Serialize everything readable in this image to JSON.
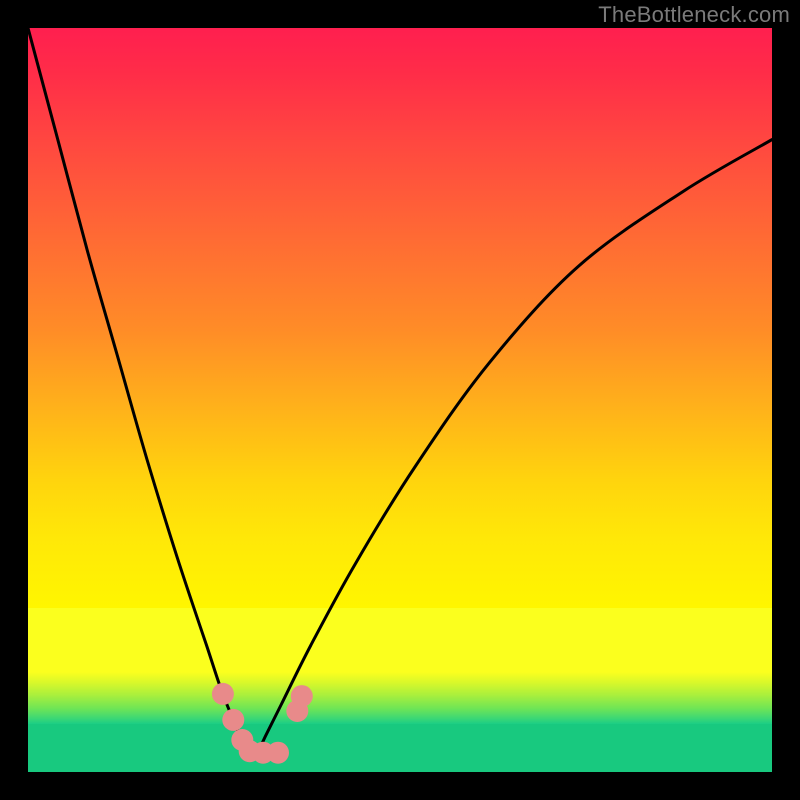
{
  "watermark": "TheBottleneck.com",
  "chart_data": {
    "type": "line",
    "title": "",
    "xlabel": "",
    "ylabel": "",
    "xlim": [
      0,
      100
    ],
    "ylim": [
      0,
      100
    ],
    "grid": false,
    "legend": false,
    "series": [
      {
        "name": "bottleneck-curve",
        "x": [
          0,
          4,
          8,
          12,
          16,
          20,
          24,
          26,
          28,
          29,
          30,
          31,
          32,
          34,
          38,
          44,
          52,
          62,
          74,
          88,
          100
        ],
        "y": [
          100,
          85,
          70,
          56,
          42,
          29,
          17,
          11,
          6,
          3.5,
          2.5,
          3,
          5,
          9,
          17,
          28,
          41,
          55,
          68,
          78,
          85
        ]
      }
    ],
    "markers": [
      {
        "name": "dot-left-1",
        "x": 26.2,
        "y": 10.5
      },
      {
        "name": "dot-left-2",
        "x": 27.6,
        "y": 7.0
      },
      {
        "name": "dot-left-3",
        "x": 28.8,
        "y": 4.3
      },
      {
        "name": "dot-bottom-1",
        "x": 29.8,
        "y": 2.8
      },
      {
        "name": "dot-bottom-2",
        "x": 31.6,
        "y": 2.6
      },
      {
        "name": "dot-bottom-3",
        "x": 33.6,
        "y": 2.6
      },
      {
        "name": "dot-right-1",
        "x": 36.2,
        "y": 8.2
      },
      {
        "name": "dot-right-2",
        "x": 36.8,
        "y": 10.2
      }
    ],
    "marker_color": "#e88a8a",
    "curve_color": "#000000",
    "gradient_stops": [
      {
        "pos": 0.0,
        "color": "#ff1f4f"
      },
      {
        "pos": 0.35,
        "color": "#ff7a2e"
      },
      {
        "pos": 0.7,
        "color": "#ffd60a"
      },
      {
        "pos": 0.82,
        "color": "#fbff1e"
      },
      {
        "pos": 0.9,
        "color": "#8ce94a"
      },
      {
        "pos": 1.0,
        "color": "#18c97f"
      }
    ]
  }
}
